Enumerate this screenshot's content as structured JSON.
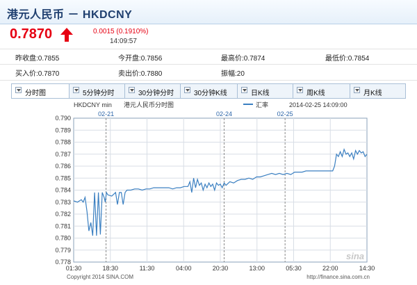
{
  "header": {
    "title": "港元人民币 － HKDCNY"
  },
  "quote": {
    "price": "0.7870",
    "change": "0.0015 (0.1910%)",
    "time": "14:09:57",
    "up_color": "#e60012"
  },
  "stats": {
    "row1": [
      {
        "label": "昨收盘:",
        "value": "0.7855"
      },
      {
        "label": "今开盘:",
        "value": "0.7856"
      },
      {
        "label": "最高价:",
        "value": "0.7874"
      },
      {
        "label": "最低价:",
        "value": "0.7854"
      }
    ],
    "row2": [
      {
        "label": "买入价:",
        "value": "0.7870"
      },
      {
        "label": "卖出价:",
        "value": "0.7880"
      },
      {
        "label": "振幅:",
        "value": "20"
      }
    ]
  },
  "tabs": [
    {
      "label": "分时图",
      "active": true
    },
    {
      "label": "5分钟分时",
      "active": false
    },
    {
      "label": "30分钟分时",
      "active": false
    },
    {
      "label": "30分钟K线",
      "active": false
    },
    {
      "label": "日K线",
      "active": false
    },
    {
      "label": "周K线",
      "active": false
    },
    {
      "label": "月K线",
      "active": false
    }
  ],
  "chart_data": {
    "type": "line",
    "symbol_label": "HKDCNY min",
    "title": "港元人民币分时图",
    "legend": "汇率",
    "timestamp": "2014-02-25 14:09:00",
    "date_markers": [
      "02-21",
      "02-24",
      "02-25"
    ],
    "date_marker_positions": [
      8.5,
      39.5,
      55.5
    ],
    "x_ticks": [
      "01:30",
      "18:30",
      "11:30",
      "04:00",
      "20:30",
      "13:00",
      "05:30",
      "22:00",
      "14:30"
    ],
    "y_ticks": [
      "0.790",
      "0.789",
      "0.788",
      "0.787",
      "0.786",
      "0.785",
      "0.784",
      "0.783",
      "0.782",
      "0.781",
      "0.780",
      "0.779",
      "0.778"
    ],
    "ylim": [
      0.778,
      0.79
    ],
    "line_color": "#3a7fc1",
    "watermark": "sina",
    "footer_left": "Copyright 2014 SINA.COM",
    "footer_right": "http://finance.sina.com.cn",
    "series": [
      {
        "values": [
          [
            0,
            0.7831
          ],
          [
            1,
            0.783
          ],
          [
            2,
            0.7832
          ],
          [
            2.5,
            0.783
          ],
          [
            3,
            0.7834
          ],
          [
            3.5,
            0.7822
          ],
          [
            4,
            0.7806
          ],
          [
            4.5,
            0.7813
          ],
          [
            5,
            0.7802
          ],
          [
            5.5,
            0.7838
          ],
          [
            6,
            0.7802
          ],
          [
            6.5,
            0.7838
          ],
          [
            7,
            0.7803
          ],
          [
            7.5,
            0.7838
          ],
          [
            8,
            0.7834
          ],
          [
            8.3,
            0.783
          ],
          [
            8.6,
            0.7838
          ],
          [
            9,
            0.7836
          ],
          [
            10,
            0.7835
          ],
          [
            11,
            0.7838
          ],
          [
            11.5,
            0.7828
          ],
          [
            12,
            0.7838
          ],
          [
            12.5,
            0.7838
          ],
          [
            13,
            0.7828
          ],
          [
            13.5,
            0.7838
          ],
          [
            14,
            0.784
          ],
          [
            15,
            0.784
          ],
          [
            16,
            0.7841
          ],
          [
            17,
            0.7841
          ],
          [
            18,
            0.784
          ],
          [
            19,
            0.7841
          ],
          [
            20,
            0.7841
          ],
          [
            21,
            0.7842
          ],
          [
            22,
            0.7842
          ],
          [
            23,
            0.7842
          ],
          [
            24,
            0.7842
          ],
          [
            25,
            0.7842
          ],
          [
            26,
            0.7841
          ],
          [
            27,
            0.7842
          ],
          [
            28,
            0.7842
          ],
          [
            29,
            0.7843
          ],
          [
            30,
            0.7843
          ],
          [
            30.5,
            0.7847
          ],
          [
            31,
            0.7838
          ],
          [
            31.5,
            0.785
          ],
          [
            32,
            0.7842
          ],
          [
            32.5,
            0.7849
          ],
          [
            33,
            0.7844
          ],
          [
            33.5,
            0.7846
          ],
          [
            34,
            0.784
          ],
          [
            34.5,
            0.7845
          ],
          [
            35,
            0.7842
          ],
          [
            35.5,
            0.7846
          ],
          [
            36,
            0.7843
          ],
          [
            36.5,
            0.7845
          ],
          [
            37,
            0.784
          ],
          [
            37.5,
            0.7846
          ],
          [
            38,
            0.7844
          ],
          [
            38.5,
            0.7845
          ],
          [
            39,
            0.7842
          ],
          [
            39.5,
            0.7846
          ],
          [
            40,
            0.7844
          ],
          [
            41,
            0.7847
          ],
          [
            42,
            0.7846
          ],
          [
            43,
            0.7848
          ],
          [
            44,
            0.7849
          ],
          [
            45,
            0.7849
          ],
          [
            46,
            0.785
          ],
          [
            47,
            0.7849
          ],
          [
            48,
            0.7851
          ],
          [
            49,
            0.7851
          ],
          [
            50,
            0.7852
          ],
          [
            51,
            0.7853
          ],
          [
            52,
            0.7854
          ],
          [
            53,
            0.7853
          ],
          [
            54,
            0.7854
          ],
          [
            55,
            0.7853
          ],
          [
            56,
            0.7854
          ],
          [
            57,
            0.7853
          ],
          [
            58,
            0.7855
          ],
          [
            59,
            0.7855
          ],
          [
            60,
            0.7855
          ],
          [
            61,
            0.7856
          ],
          [
            62,
            0.7856
          ],
          [
            63,
            0.7856
          ],
          [
            64,
            0.7856
          ],
          [
            65,
            0.7856
          ],
          [
            66,
            0.7856
          ],
          [
            67,
            0.7856
          ],
          [
            68,
            0.7856
          ],
          [
            68.5,
            0.786
          ],
          [
            69,
            0.787
          ],
          [
            69.5,
            0.7868
          ],
          [
            70,
            0.7872
          ],
          [
            70.5,
            0.7868
          ],
          [
            71,
            0.7874
          ],
          [
            71.5,
            0.787
          ],
          [
            72,
            0.7871
          ],
          [
            72.5,
            0.7868
          ],
          [
            73,
            0.7871
          ],
          [
            73.5,
            0.7866
          ],
          [
            74,
            0.7873
          ],
          [
            74.5,
            0.787
          ],
          [
            75,
            0.7873
          ],
          [
            75.5,
            0.7871
          ],
          [
            76,
            0.7872
          ],
          [
            76.5,
            0.7868
          ],
          [
            77,
            0.787
          ]
        ]
      }
    ],
    "x_range": [
      0,
      77
    ]
  }
}
